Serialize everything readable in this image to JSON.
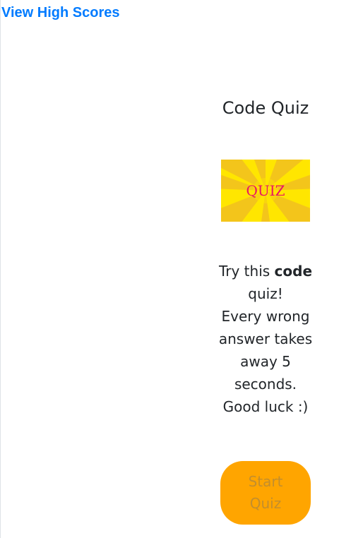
{
  "header": {
    "high_scores_link": "View High Scores"
  },
  "quiz": {
    "title": "Code Quiz",
    "banner": {
      "label": "QUIZ",
      "colors": {
        "background": "#ffe600",
        "rays": "#f3c51b",
        "text": "#e81565"
      }
    },
    "instructions": {
      "lead": "Try this ",
      "emphasis": "code",
      "tail": " quiz!",
      "line_2": "Every wrong answer takes away 5 seconds.",
      "line_3": "Good luck :)"
    },
    "start_button": {
      "label": "Start Quiz",
      "colors": {
        "background": "#ffa500",
        "text": "#c38e2d"
      }
    }
  },
  "colors": {
    "link": "#007bff",
    "text": "#212529"
  }
}
